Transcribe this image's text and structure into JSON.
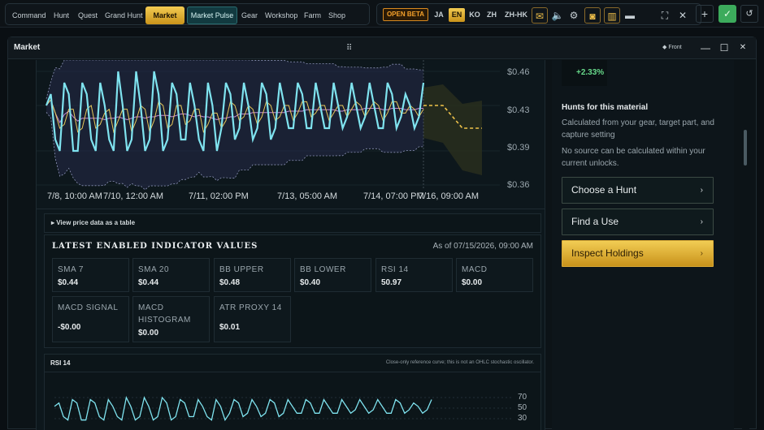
{
  "nav": {
    "items": [
      "Command",
      "Hunt",
      "Quest",
      "Grand Hunt",
      "Market",
      "Market Pulse",
      "Gear",
      "Workshop",
      "Farm",
      "Shop"
    ],
    "active": "Market"
  },
  "topbar": {
    "beta_label": "OPEN BETA",
    "languages": [
      "JA",
      "EN",
      "KO",
      "ZH",
      "ZH-HK"
    ],
    "active_language": "EN",
    "icons": [
      "mail-icon",
      "volume-icon",
      "settings-icon",
      "discord-icon",
      "book-icon",
      "minimize-icon",
      "fullscreen-icon",
      "close-icon",
      "plus-icon",
      "check-icon",
      "refresh-icon"
    ]
  },
  "window": {
    "title": "Market",
    "front_label": "Front"
  },
  "chart_data": {
    "type": "line",
    "y_ticks": [
      "$0.46",
      "$0.43",
      "$0.39",
      "$0.36"
    ],
    "ylim": [
      0.36,
      0.46
    ],
    "x_tick_labels": [
      "7/8, 10:00 AM",
      "7/10, 12:00 AM",
      "7/11, 02:00 PM",
      "7/13, 05:00 AM",
      "7/14, 07:00 PM",
      "7/16, 09:00 AM"
    ],
    "series": [
      {
        "values": [
          0.43,
          0.44,
          0.4,
          0.39,
          0.45,
          0.44,
          0.39,
          0.39,
          0.45,
          0.44,
          0.4,
          0.39,
          0.45,
          0.43,
          0.4,
          0.39,
          0.46,
          0.43,
          0.39,
          0.4,
          0.46,
          0.43,
          0.39,
          0.4,
          0.46,
          0.44,
          0.39,
          0.4,
          0.45,
          0.44,
          0.4,
          0.4,
          0.45,
          0.43,
          0.4,
          0.39,
          0.45,
          0.43,
          0.39,
          0.41,
          0.45,
          0.44,
          0.4,
          0.41,
          0.45,
          0.43,
          0.4,
          0.41,
          0.45,
          0.44,
          0.4,
          0.41,
          0.45,
          0.43,
          0.41,
          0.41,
          0.45,
          0.44,
          0.41,
          0.41,
          0.45,
          0.43,
          0.41,
          0.41,
          0.45,
          0.43,
          0.41,
          0.42,
          0.45,
          0.43,
          0.41,
          0.42,
          0.45,
          0.43,
          0.41,
          0.41,
          0.45,
          0.44,
          0.41,
          0.42,
          0.44,
          0.43,
          0.41,
          0.42,
          0.45
        ]
      },
      {
        "values": []
      },
      {
        "values": []
      }
    ],
    "forecast": [
      0.43,
      0.43,
      0.43,
      0.42,
      0.41,
      0.41,
      0.41
    ]
  },
  "table_toggle": "▸ View price data as a table",
  "indicators": {
    "title": "LATEST ENABLED INDICATOR VALUES",
    "as_of": "As of 07/15/2026, 09:00 AM",
    "cards": [
      {
        "label": "SMA 7",
        "value": "$0.44"
      },
      {
        "label": "SMA 20",
        "value": "$0.44"
      },
      {
        "label": "BB UPPER",
        "value": "$0.48"
      },
      {
        "label": "BB LOWER",
        "value": "$0.40"
      },
      {
        "label": "RSI 14",
        "value": "50.97"
      },
      {
        "label": "MACD",
        "value": "$0.00"
      },
      {
        "label": "MACD SIGNAL",
        "value": "-$0.00"
      },
      {
        "label": "MACD HISTOGRAM",
        "value": "$0.00"
      },
      {
        "label": "ATR PROXY 14",
        "value": "$0.01"
      }
    ]
  },
  "rsi": {
    "title": "RSI 14",
    "note": "Close-only reference curve; this is not an OHLC stochastic oscillator.",
    "y_ticks": [
      "70",
      "50",
      "30"
    ]
  },
  "side": {
    "change": "+2.33%",
    "hunts_title": "Hunts for this material",
    "hunts_desc": "Calculated from your gear, target part, and capture setting",
    "no_source": "No source can be calculated within your current unlocks.",
    "buttons": [
      "Choose a Hunt",
      "Find a Use",
      "Inspect Holdings"
    ]
  },
  "colors": {
    "accent_gold": "#f0c34a",
    "price_line": "#7fe3ef",
    "sma_yellow": "#e8c95a",
    "sma_purple": "#c48bd6",
    "positive": "#67d98a"
  }
}
